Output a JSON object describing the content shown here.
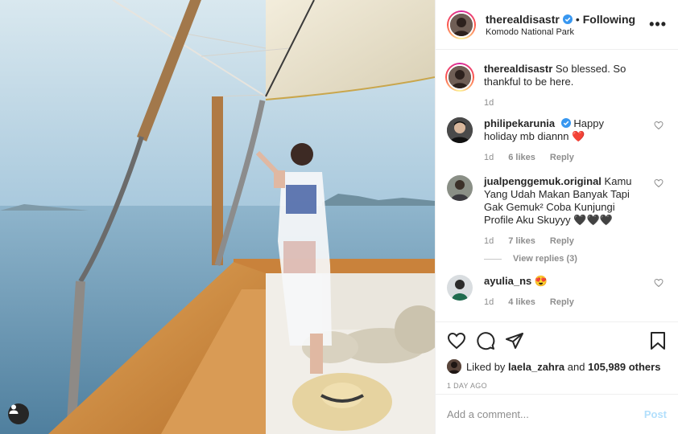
{
  "header": {
    "username": "therealdisastr",
    "separator": "•",
    "follow_status": "Following",
    "location": "Komodo National Park",
    "more_icon": "more-horizontal-icon"
  },
  "caption": {
    "username": "therealdisastr",
    "text": "So blessed. So thankful to be here.",
    "time": "1d"
  },
  "comments": [
    {
      "username": "philipekarunia",
      "verified": true,
      "text": "Happy holiday mb diannn ❤️",
      "time": "1d",
      "likes": "6 likes",
      "reply": "Reply"
    },
    {
      "username": "jualpenggemuk.original",
      "verified": false,
      "text": "Kamu Yang Udah Makan Banyak Tapi Gak Gemuk² Coba Kunjungi Profile Aku Skuyyy 🖤🖤🖤",
      "time": "1d",
      "likes": "7 likes",
      "reply": "Reply",
      "view_replies": "View replies (3)"
    },
    {
      "username": "ayulia_ns",
      "verified": false,
      "text": "😍",
      "time": "1d",
      "likes": "4 likes",
      "reply": "Reply"
    }
  ],
  "likes": {
    "prefix": "Liked by",
    "liker": "laela_zahra",
    "connector": "and",
    "others": "105,989 others"
  },
  "timestamp": "1 DAY AGO",
  "add_comment": {
    "placeholder": "Add a comment...",
    "post_label": "Post"
  },
  "colors": {
    "verified": "#3897f0",
    "post_button": "#b2dffc",
    "muted": "#8e8e8e"
  }
}
